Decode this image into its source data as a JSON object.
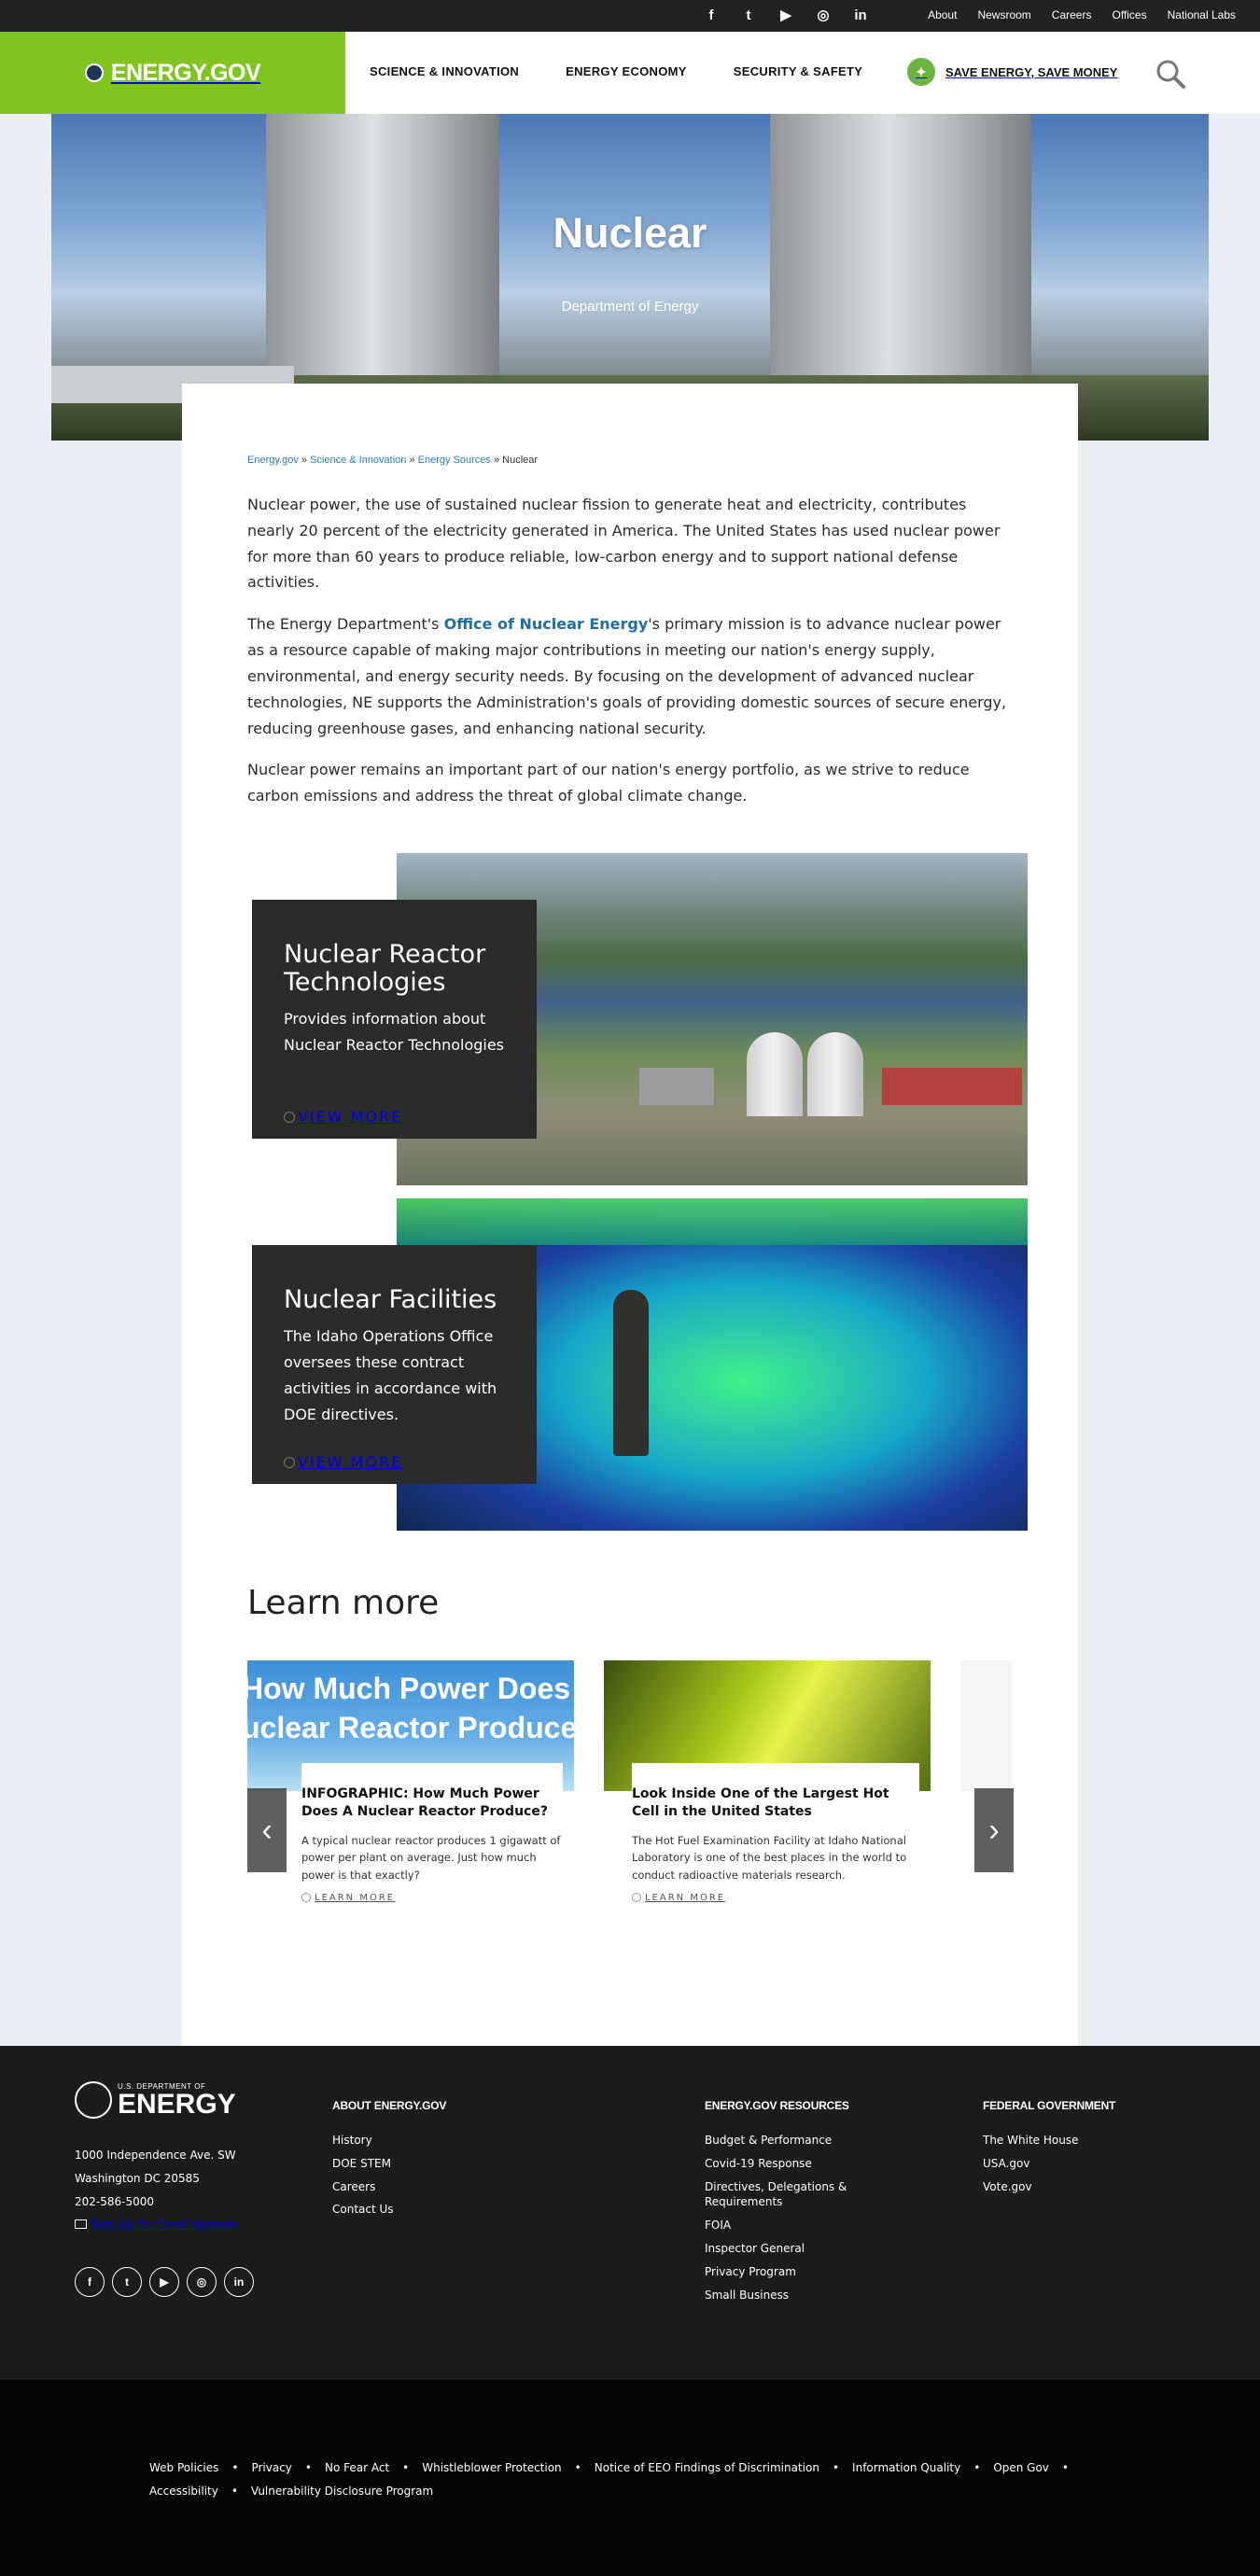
{
  "utility_bar": {
    "social": [
      {
        "name": "facebook-icon",
        "glyph": "f"
      },
      {
        "name": "twitter-icon",
        "glyph": "t"
      },
      {
        "name": "youtube-icon",
        "glyph": "▶"
      },
      {
        "name": "instagram-icon",
        "glyph": "◎"
      },
      {
        "name": "linkedin-icon",
        "glyph": "in"
      }
    ],
    "links": [
      "About",
      "Newsroom",
      "Careers",
      "Offices",
      "National Labs"
    ]
  },
  "header": {
    "logo": "ENERGY.GOV",
    "nav": [
      "SCIENCE & INNOVATION",
      "ENERGY ECONOMY",
      "SECURITY & SAFETY"
    ],
    "save_energy": "SAVE ENERGY, SAVE MONEY",
    "accent_color": "#7fc41f"
  },
  "hero": {
    "title": "Nuclear",
    "subtitle": "Department of Energy"
  },
  "breadcrumb": {
    "items": [
      "Energy.gov",
      "Science & Innovation",
      "Energy Sources"
    ],
    "current": "Nuclear"
  },
  "intro": {
    "p1": "Nuclear power, the use of sustained nuclear fission to generate heat and electricity, contributes nearly 20 percent of the electricity generated in America. The United States has used nuclear power for more than 60 years to produce reliable, low-carbon energy and to support national defense activities.",
    "p2_before": "The Energy Department's ",
    "p2_link": "Office of Nuclear Energy",
    "p2_after": "'s primary mission is to advance nuclear power as a resource capable of making major contributions in meeting our nation's energy supply, environmental, and energy security needs. By focusing on the development of advanced nuclear technologies, NE supports the Administration's goals of providing domestic sources of secure energy, reducing greenhouse gases, and enhancing national security.",
    "p3": "Nuclear power remains an important part of our nation's energy portfolio, as we strive to reduce carbon emissions and address the threat of global climate change."
  },
  "features": [
    {
      "title": "Nuclear Reactor Technologies",
      "desc": "Provides information about Nuclear Reactor Technologies",
      "cta": "VIEW MORE"
    },
    {
      "title": "Nuclear Facilities",
      "desc": "The Idaho Operations Office oversees these contract activities in accordance with DOE directives.",
      "cta": "VIEW MORE"
    }
  ],
  "learn_more": {
    "title": "Learn more",
    "cards": [
      {
        "thumb_text_1": "How Much Power Does a",
        "thumb_text_2": "uclear Reactor Produce",
        "title": "INFOGRAPHIC: How Much Power Does A Nuclear Reactor Produce?",
        "desc": "A typical nuclear reactor produces 1 gigawatt of power per plant on average. Just how much power is that exactly?",
        "cta": "LEARN MORE"
      },
      {
        "title": "Look Inside One of the Largest Hot Cell in the United States",
        "desc": "The Hot Fuel Examination Facility at Idaho National Laboratory is one of the best places in the world to conduct radioactive materials research.",
        "cta": "LEARN MORE"
      }
    ]
  },
  "footer": {
    "logo_small": "U.S. DEPARTMENT OF",
    "logo_big": "ENERGY",
    "address": [
      "1000 Independence Ave. SW",
      "Washington DC 20585",
      "202-586-5000"
    ],
    "signup": "Sign Up for Email Updates",
    "social": [
      {
        "name": "facebook-icon",
        "glyph": "f"
      },
      {
        "name": "twitter-icon",
        "glyph": "t"
      },
      {
        "name": "youtube-icon",
        "glyph": "▶"
      },
      {
        "name": "instagram-icon",
        "glyph": "◎"
      },
      {
        "name": "linkedin-icon",
        "glyph": "in"
      }
    ],
    "columns": [
      {
        "heading": "ABOUT ENERGY.GOV",
        "links": [
          "History",
          "DOE STEM",
          "Careers",
          "Contact Us"
        ]
      },
      {
        "heading": "ENERGY.GOV RESOURCES",
        "links": [
          "Budget & Performance",
          "Covid-19 Response",
          "Directives, Delegations & Requirements",
          "FOIA",
          "Inspector General",
          "Privacy Program",
          "Small Business"
        ]
      },
      {
        "heading": "FEDERAL GOVERNMENT",
        "links": [
          "The White House",
          "USA.gov",
          "Vote.gov"
        ]
      }
    ]
  },
  "subfooter": {
    "links": [
      "Web Policies",
      "Privacy",
      "No Fear Act",
      "Whistleblower Protection",
      "Notice of EEO Findings of Discrimination",
      "Information Quality",
      "Open Gov",
      "Accessibility",
      "Vulnerability Disclosure Program"
    ]
  }
}
